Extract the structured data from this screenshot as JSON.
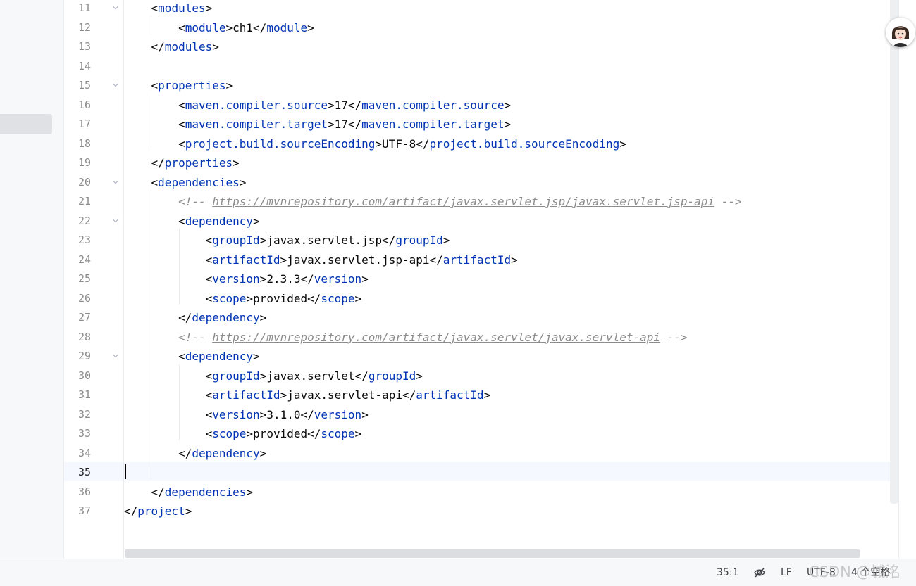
{
  "editor": {
    "current_line": 35,
    "lines": [
      {
        "n": "11",
        "fold": true,
        "tokens": [
          [
            "b",
            "    <"
          ],
          [
            "t",
            "modules"
          ],
          [
            "b",
            ">"
          ]
        ]
      },
      {
        "n": "12",
        "fold": false,
        "tokens": [
          [
            "b",
            "        <"
          ],
          [
            "t",
            "module"
          ],
          [
            "b",
            ">"
          ],
          [
            "x",
            "ch1"
          ],
          [
            "b",
            "</"
          ],
          [
            "t",
            "module"
          ],
          [
            "b",
            ">"
          ]
        ]
      },
      {
        "n": "13",
        "fold": false,
        "tokens": [
          [
            "b",
            "    </"
          ],
          [
            "t",
            "modules"
          ],
          [
            "b",
            ">"
          ]
        ]
      },
      {
        "n": "14",
        "fold": false,
        "tokens": []
      },
      {
        "n": "15",
        "fold": true,
        "tokens": [
          [
            "b",
            "    <"
          ],
          [
            "t",
            "properties"
          ],
          [
            "b",
            ">"
          ]
        ]
      },
      {
        "n": "16",
        "fold": false,
        "tokens": [
          [
            "b",
            "        <"
          ],
          [
            "t",
            "maven.compiler.source"
          ],
          [
            "b",
            ">"
          ],
          [
            "x",
            "17"
          ],
          [
            "b",
            "</"
          ],
          [
            "t",
            "maven.compiler.source"
          ],
          [
            "b",
            ">"
          ]
        ]
      },
      {
        "n": "17",
        "fold": false,
        "tokens": [
          [
            "b",
            "        <"
          ],
          [
            "t",
            "maven.compiler.target"
          ],
          [
            "b",
            ">"
          ],
          [
            "x",
            "17"
          ],
          [
            "b",
            "</"
          ],
          [
            "t",
            "maven.compiler.target"
          ],
          [
            "b",
            ">"
          ]
        ]
      },
      {
        "n": "18",
        "fold": false,
        "tokens": [
          [
            "b",
            "        <"
          ],
          [
            "t",
            "project.build.sourceEncoding"
          ],
          [
            "b",
            ">"
          ],
          [
            "x",
            "UTF-8"
          ],
          [
            "b",
            "</"
          ],
          [
            "t",
            "project.build.sourceEncoding"
          ],
          [
            "b",
            ">"
          ]
        ]
      },
      {
        "n": "19",
        "fold": false,
        "tokens": [
          [
            "b",
            "    </"
          ],
          [
            "t",
            "properties"
          ],
          [
            "b",
            ">"
          ]
        ]
      },
      {
        "n": "20",
        "fold": true,
        "tokens": [
          [
            "b",
            "    <"
          ],
          [
            "t",
            "dependencies"
          ],
          [
            "b",
            ">"
          ]
        ]
      },
      {
        "n": "21",
        "fold": false,
        "tokens": [
          [
            "b",
            "        "
          ],
          [
            "c",
            "<!-- "
          ],
          [
            "cu",
            "https://mvnrepository.com/artifact/javax.servlet.jsp/javax.servlet.jsp-api"
          ],
          [
            "c",
            " -->"
          ]
        ]
      },
      {
        "n": "22",
        "fold": true,
        "tokens": [
          [
            "b",
            "        <"
          ],
          [
            "t",
            "dependency"
          ],
          [
            "b",
            ">"
          ]
        ]
      },
      {
        "n": "23",
        "fold": false,
        "tokens": [
          [
            "b",
            "            <"
          ],
          [
            "t",
            "groupId"
          ],
          [
            "b",
            ">"
          ],
          [
            "x",
            "javax.servlet.jsp"
          ],
          [
            "b",
            "</"
          ],
          [
            "t",
            "groupId"
          ],
          [
            "b",
            ">"
          ]
        ]
      },
      {
        "n": "24",
        "fold": false,
        "tokens": [
          [
            "b",
            "            <"
          ],
          [
            "t",
            "artifactId"
          ],
          [
            "b",
            ">"
          ],
          [
            "x",
            "javax.servlet.jsp-api"
          ],
          [
            "b",
            "</"
          ],
          [
            "t",
            "artifactId"
          ],
          [
            "b",
            ">"
          ]
        ]
      },
      {
        "n": "25",
        "fold": false,
        "tokens": [
          [
            "b",
            "            <"
          ],
          [
            "t",
            "version"
          ],
          [
            "b",
            ">"
          ],
          [
            "x",
            "2.3.3"
          ],
          [
            "b",
            "</"
          ],
          [
            "t",
            "version"
          ],
          [
            "b",
            ">"
          ]
        ]
      },
      {
        "n": "26",
        "fold": false,
        "tokens": [
          [
            "b",
            "            <"
          ],
          [
            "t",
            "scope"
          ],
          [
            "b",
            ">"
          ],
          [
            "x",
            "provided"
          ],
          [
            "b",
            "</"
          ],
          [
            "t",
            "scope"
          ],
          [
            "b",
            ">"
          ]
        ]
      },
      {
        "n": "27",
        "fold": false,
        "tokens": [
          [
            "b",
            "        </"
          ],
          [
            "t",
            "dependency"
          ],
          [
            "b",
            ">"
          ]
        ]
      },
      {
        "n": "28",
        "fold": false,
        "tokens": [
          [
            "b",
            "        "
          ],
          [
            "c",
            "<!-- "
          ],
          [
            "cu",
            "https://mvnrepository.com/artifact/javax.servlet/javax.servlet-api"
          ],
          [
            "c",
            " -->"
          ]
        ]
      },
      {
        "n": "29",
        "fold": true,
        "tokens": [
          [
            "b",
            "        <"
          ],
          [
            "t",
            "dependency"
          ],
          [
            "b",
            ">"
          ]
        ]
      },
      {
        "n": "30",
        "fold": false,
        "tokens": [
          [
            "b",
            "            <"
          ],
          [
            "t",
            "groupId"
          ],
          [
            "b",
            ">"
          ],
          [
            "x",
            "javax.servlet"
          ],
          [
            "b",
            "</"
          ],
          [
            "t",
            "groupId"
          ],
          [
            "b",
            ">"
          ]
        ]
      },
      {
        "n": "31",
        "fold": false,
        "tokens": [
          [
            "b",
            "            <"
          ],
          [
            "t",
            "artifactId"
          ],
          [
            "b",
            ">"
          ],
          [
            "x",
            "javax.servlet-api"
          ],
          [
            "b",
            "</"
          ],
          [
            "t",
            "artifactId"
          ],
          [
            "b",
            ">"
          ]
        ]
      },
      {
        "n": "32",
        "fold": false,
        "tokens": [
          [
            "b",
            "            <"
          ],
          [
            "t",
            "version"
          ],
          [
            "b",
            ">"
          ],
          [
            "x",
            "3.1.0"
          ],
          [
            "b",
            "</"
          ],
          [
            "t",
            "version"
          ],
          [
            "b",
            ">"
          ]
        ]
      },
      {
        "n": "33",
        "fold": false,
        "tokens": [
          [
            "b",
            "            <"
          ],
          [
            "t",
            "scope"
          ],
          [
            "b",
            ">"
          ],
          [
            "x",
            "provided"
          ],
          [
            "b",
            "</"
          ],
          [
            "t",
            "scope"
          ],
          [
            "b",
            ">"
          ]
        ]
      },
      {
        "n": "34",
        "fold": false,
        "tokens": [
          [
            "b",
            "        </"
          ],
          [
            "t",
            "dependency"
          ],
          [
            "b",
            ">"
          ]
        ]
      },
      {
        "n": "35",
        "fold": false,
        "tokens": []
      },
      {
        "n": "36",
        "fold": false,
        "tokens": [
          [
            "b",
            "    </"
          ],
          [
            "t",
            "dependencies"
          ],
          [
            "b",
            ">"
          ]
        ]
      },
      {
        "n": "37",
        "fold": false,
        "tokens": [
          [
            "b",
            "</"
          ],
          [
            "t",
            "project"
          ],
          [
            "b",
            ">"
          ]
        ]
      }
    ]
  },
  "statusbar": {
    "position": "35:1",
    "readonly_icon": "no-edit-icon",
    "line_separator": "LF",
    "encoding": "UTF-8",
    "indent": "4 个空格"
  },
  "watermark": "CSDN @城洺",
  "avatar_icon": "user-avatar-icon"
}
